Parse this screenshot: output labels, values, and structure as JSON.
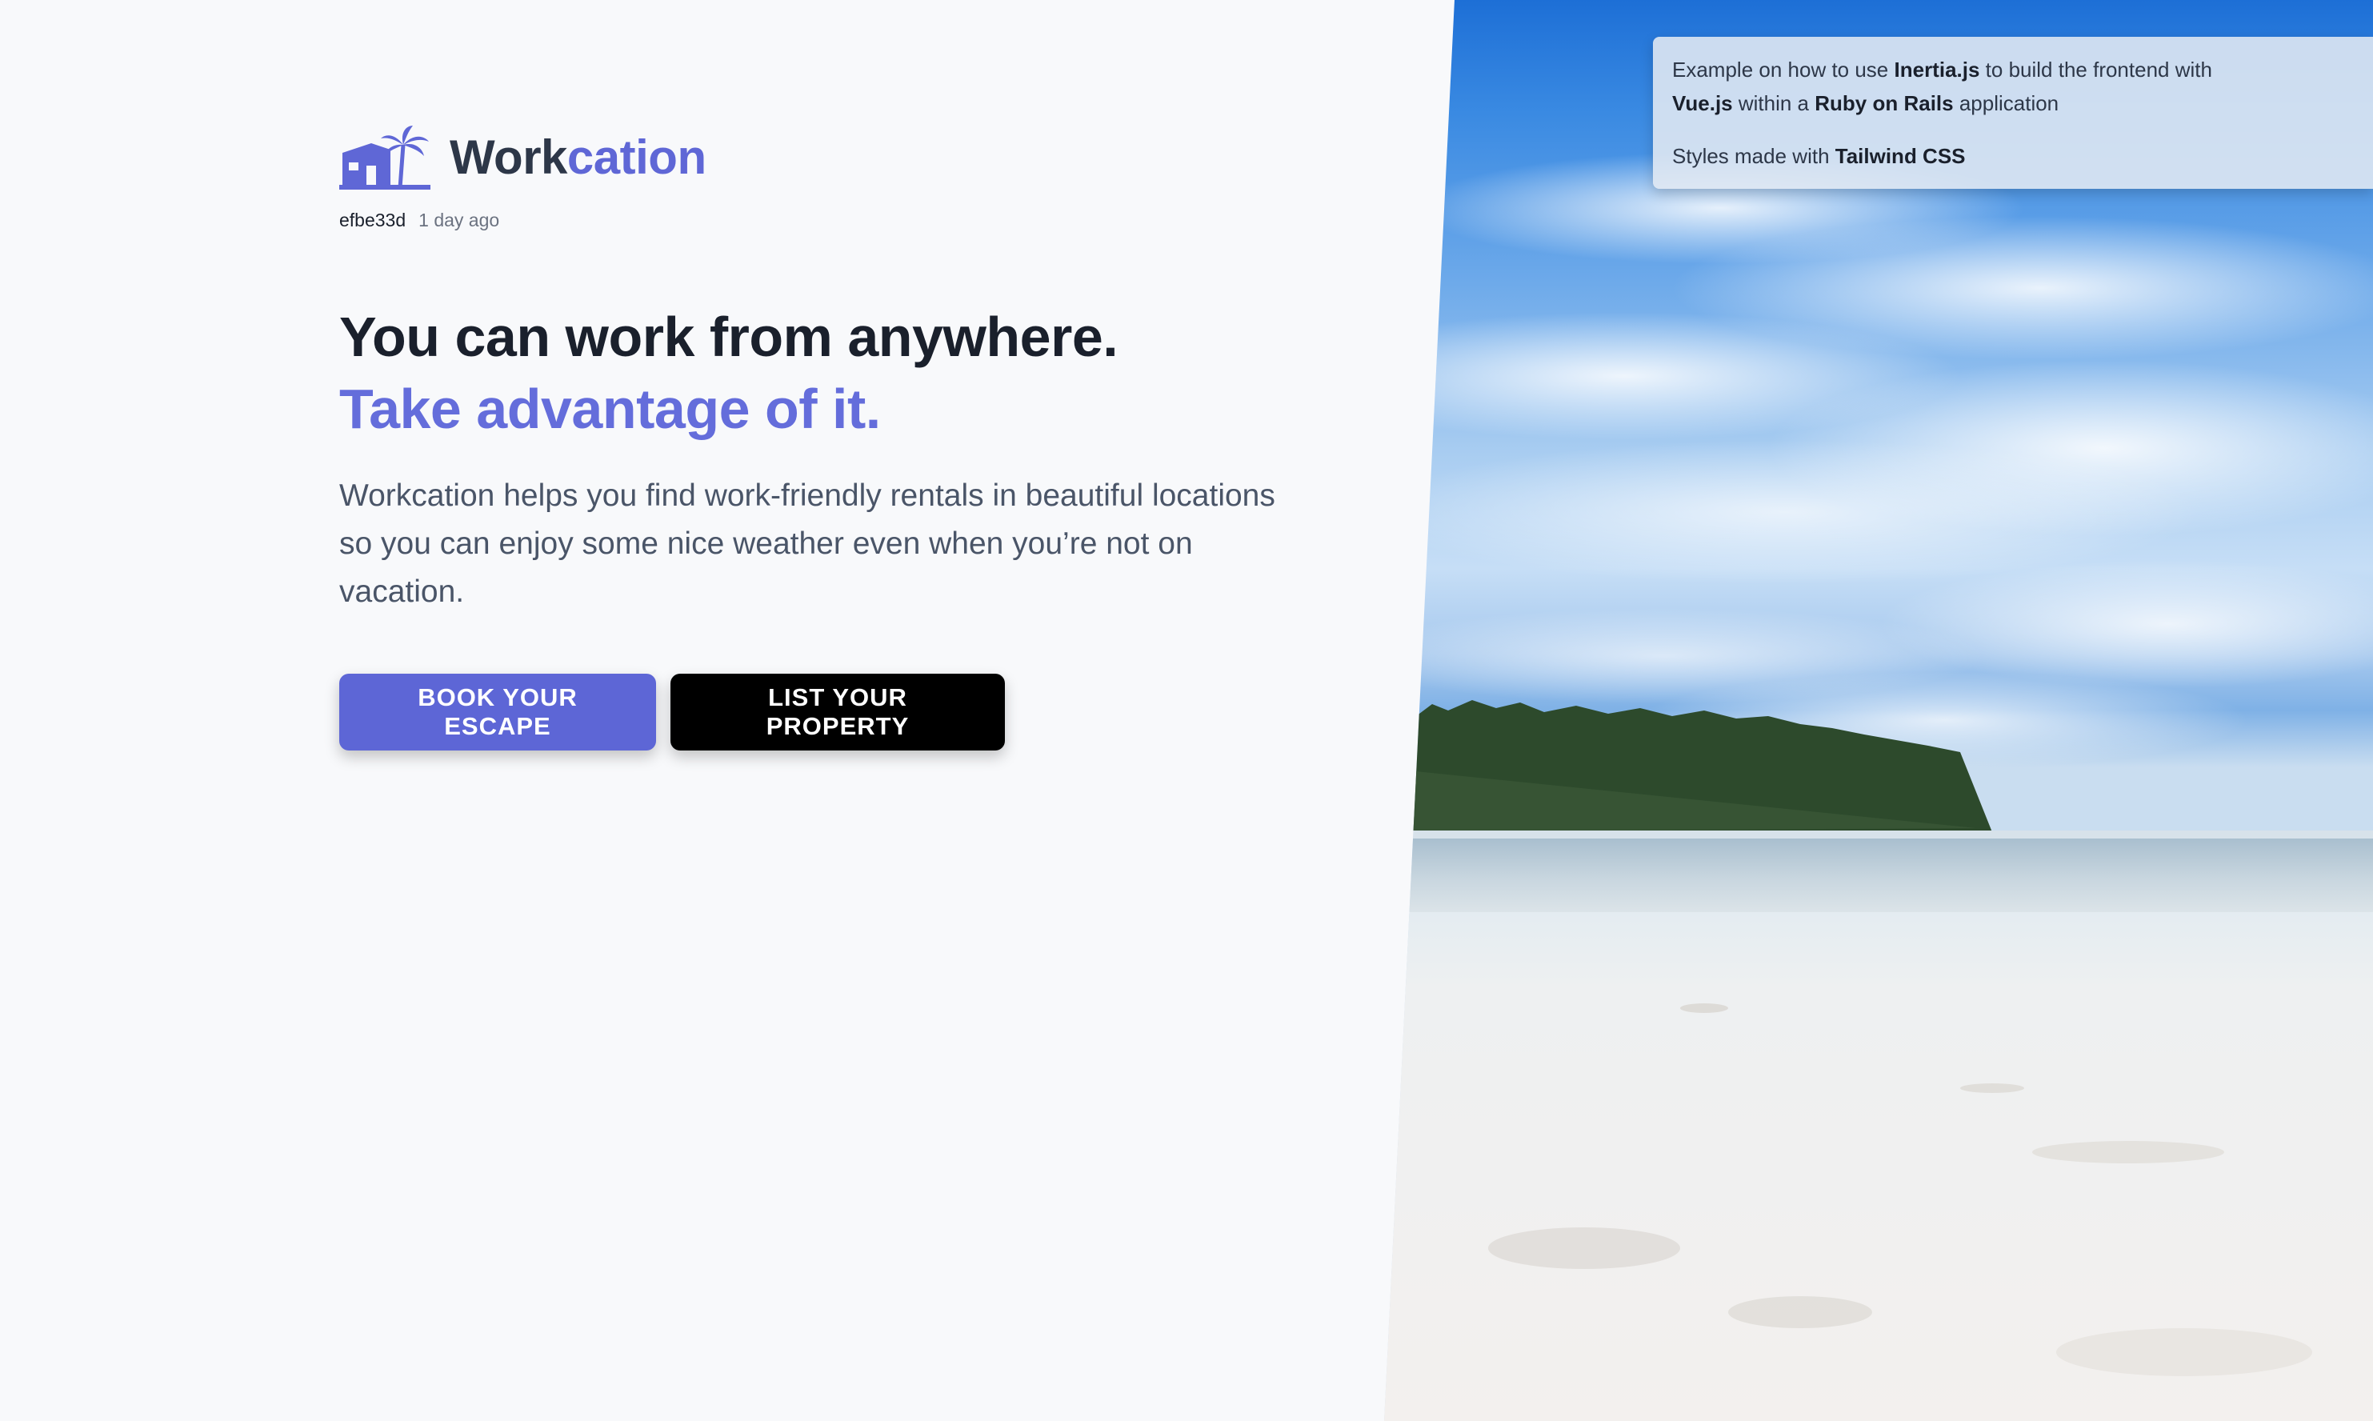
{
  "colors": {
    "accent": "#5f67d6",
    "heading": "#1a202c",
    "body_text": "#4a5568",
    "dark_button": "#000000",
    "background": "#f8f9fb"
  },
  "brand": {
    "logo_icon": "house-palm-icon",
    "name_part1": "Work",
    "name_part2": "cation"
  },
  "meta": {
    "commit": "efbe33d",
    "time": "1 day ago"
  },
  "hero": {
    "headline": "You can work from anywhere.",
    "headline_accent": "Take advantage of it.",
    "description": "Workcation helps you find work-friendly rentals in beautiful locations so you can enjoy some nice weather even when you’re not on vacation."
  },
  "buttons": {
    "primary": "BOOK YOUR ESCAPE",
    "secondary": "LIST YOUR PROPERTY"
  },
  "info": {
    "line1_pre": "Example on how to use ",
    "line1_bold1": "Inertia.js",
    "line1_mid": " to build the frontend with ",
    "line1_bold2": "Vue.js",
    "line1_mid2": " within a ",
    "line1_bold3": "Ruby on Rails",
    "line1_post": " application",
    "line2_pre": "Styles made with ",
    "line2_bold": "Tailwind CSS"
  },
  "image": {
    "subject": "beach-photo"
  }
}
